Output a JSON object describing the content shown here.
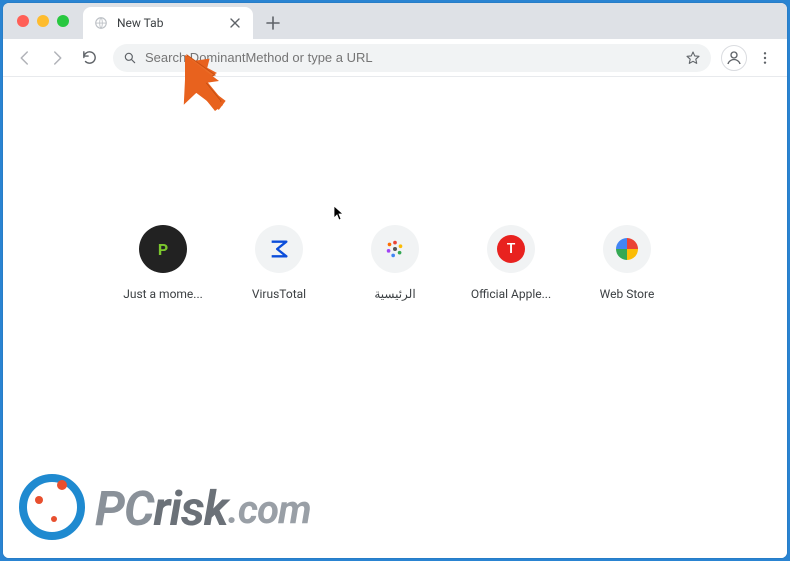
{
  "window": {
    "traffic": {
      "close": "close",
      "minimize": "minimize",
      "maximize": "maximize"
    }
  },
  "tab": {
    "title": "New Tab"
  },
  "toolbar": {
    "back": "Back",
    "forward": "Forward",
    "reload": "Reload",
    "omnibox_placeholder": "Search DominantMethod or type a URL",
    "bookmark": "Bookmark",
    "profile": "Profile",
    "menu": "Menu",
    "newtab": "New tab"
  },
  "shortcuts": [
    {
      "label": "Just a mome...",
      "icon": "p"
    },
    {
      "label": "VirusTotal",
      "icon": "sigma"
    },
    {
      "label": "الرئيسية",
      "icon": "flower"
    },
    {
      "label": "Official Apple...",
      "icon": "t"
    },
    {
      "label": "Web Store",
      "icon": "store"
    }
  ],
  "watermark": {
    "pc": "PC",
    "risk": "risk",
    "com": ".com"
  },
  "annotation": {
    "arrow_color": "#e8621e"
  }
}
